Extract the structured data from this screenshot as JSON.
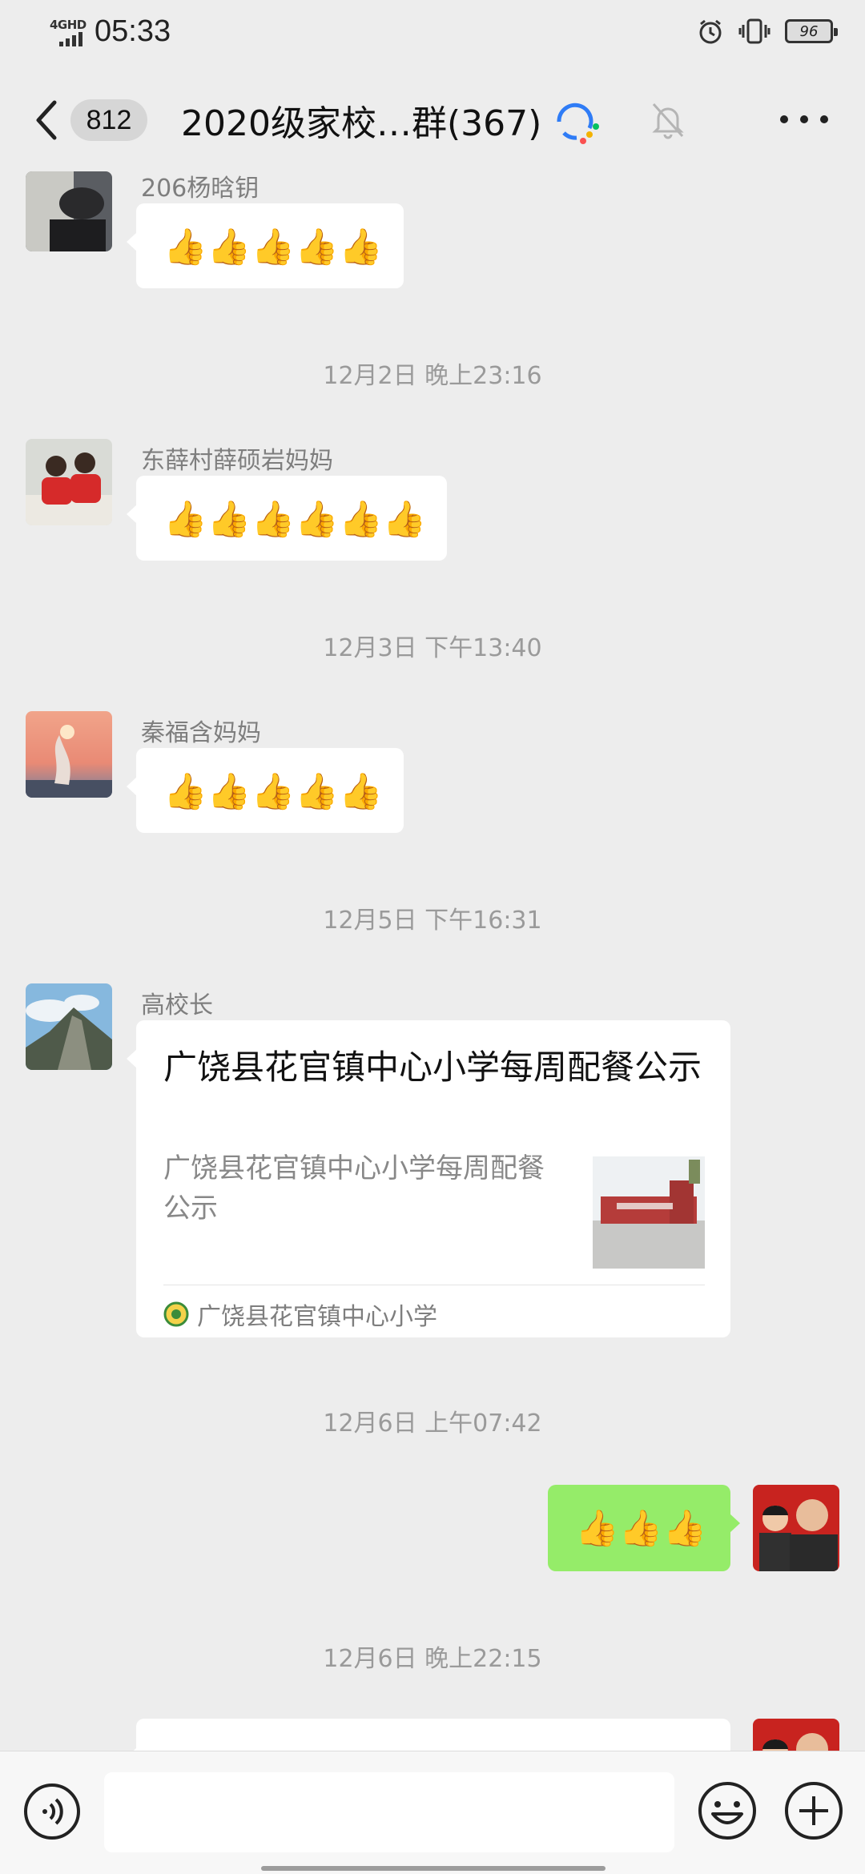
{
  "status_bar": {
    "network": "4GHD",
    "time": "05:33",
    "battery": "96"
  },
  "header": {
    "unread_count": "812",
    "title": "2020级家校…群(367)"
  },
  "messages": [
    {
      "sender": "206杨晗钥",
      "content": "👍👍👍👍👍"
    },
    {
      "timestamp": "12月2日 晚上23:16"
    },
    {
      "sender": "东薛村薛硕岩妈妈",
      "content": "👍👍👍👍👍👍"
    },
    {
      "timestamp": "12月3日 下午13:40"
    },
    {
      "sender": "秦福含妈妈",
      "content": "👍👍👍👍👍"
    },
    {
      "timestamp": "12月5日 下午16:31"
    },
    {
      "sender": "高校长",
      "card": {
        "title": "广饶县花官镇中心小学每周配餐公示",
        "description": "广饶县花官镇中心小学每周配餐公示",
        "source": "广饶县花官镇中心小学"
      }
    },
    {
      "timestamp": "12月6日 上午07:42"
    },
    {
      "sender": "me",
      "content": "👍👍👍"
    },
    {
      "timestamp": "12月6日 晚上22:15"
    }
  ],
  "colors": {
    "background": "#ededed",
    "own_bubble": "#95ec69",
    "other_bubble": "#ffffff",
    "meta_text": "#9a9a9a"
  },
  "icons": [
    "back-icon",
    "emoji-icon",
    "mute-bell-icon",
    "more-icon",
    "voice-icon",
    "smile-icon",
    "plus-icon"
  ]
}
